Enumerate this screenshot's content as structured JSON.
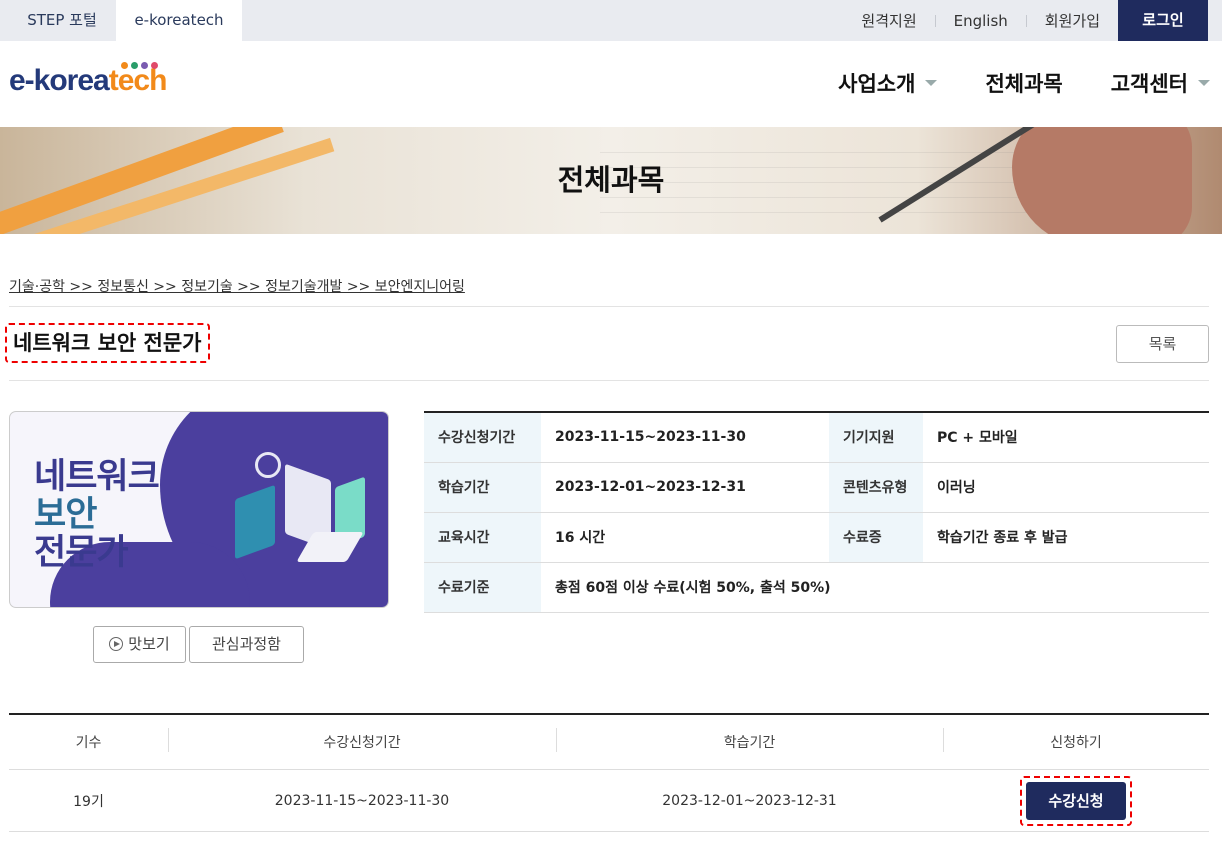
{
  "topbar": {
    "tabs": [
      "STEP 포털",
      "e-koreatech"
    ],
    "links": [
      "원격지원",
      "English",
      "회원가입"
    ],
    "login": "로그인"
  },
  "logo": {
    "part1": "e-korea",
    "part2": "tech",
    "dot_colors": [
      "#f28a1a",
      "#2a9d6a",
      "#7a5bb0",
      "#e04a6a"
    ]
  },
  "nav": [
    "사업소개",
    "전체과목",
    "고객센터"
  ],
  "banner": {
    "title": "전체과목"
  },
  "breadcrumb": "기술·공학 >> 정보통신 >> 정보기술 >> 정보기술개발 >> 보안엔지니어링",
  "course": {
    "title": "네트워크 보안 전문가",
    "list_button": "목록",
    "thumb_lines": [
      "네트워크",
      "보안",
      "전문가"
    ],
    "preview_button": "맛보기",
    "interest_button": "관심과정함"
  },
  "info": [
    {
      "label": "수강신청기간",
      "value": "2023-11-15~2023-11-30",
      "label2": "기기지원",
      "value2": "PC + 모바일"
    },
    {
      "label": "학습기간",
      "value": "2023-12-01~2023-12-31",
      "label2": "콘텐츠유형",
      "value2": "이러닝"
    },
    {
      "label": "교육시간",
      "value": "16 시간",
      "label2": "수료증",
      "value2": "학습기간 종료 후 발급"
    },
    {
      "label": "수료기준",
      "value": "총점 60점 이상 수료(시험 50%, 출석 50%)"
    }
  ],
  "schedule": {
    "headers": [
      "기수",
      "수강신청기간",
      "학습기간",
      "신청하기"
    ],
    "rows": [
      {
        "term": "19기",
        "apply_period": "2023-11-15~2023-11-30",
        "study_period": "2023-12-01~2023-12-31",
        "action": "수강신청"
      }
    ]
  },
  "colors": {
    "primary": "#1f2b5e",
    "highlight": "#ee0000",
    "info_header_bg": "#eef6fa"
  }
}
